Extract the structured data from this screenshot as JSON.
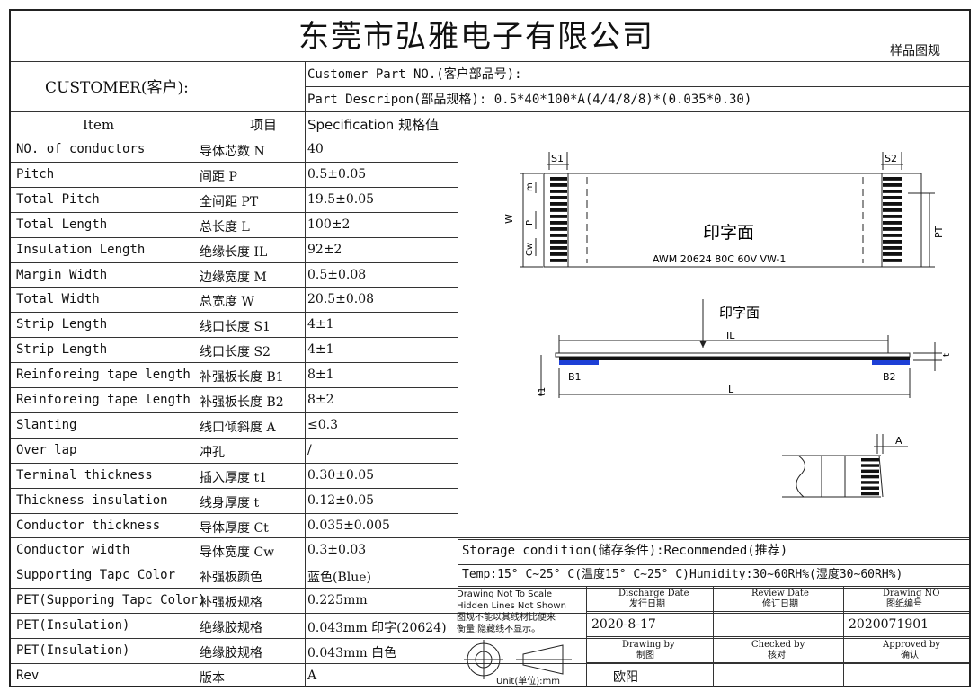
{
  "header": {
    "company": "东莞市弘雅电子有限公司",
    "doc_type": "样品图规"
  },
  "customer": {
    "label": "CUSTOMER(客户):",
    "part_no_label": "Customer Part NO.(客户部品号):",
    "part_desc": "Part Descripon(部品规格): 0.5*40*100*A(4/4/8/8)*(0.035*0.30)"
  },
  "table": {
    "head_item": "Item",
    "head_item_cn": "项目",
    "head_spec": "Specification 规格值",
    "rows": [
      {
        "en": "NO. of conductors",
        "cn": "导体芯数  N",
        "spec": "40"
      },
      {
        "en": "Pitch",
        "cn": "间距      P",
        "spec": "0.5±0.05"
      },
      {
        "en": "Total Pitch",
        "cn": "全间距    PT",
        "spec": "19.5±0.05"
      },
      {
        "en": "Total Length",
        "cn": "总长度    L",
        "spec": "100±2"
      },
      {
        "en": "Insulation Length",
        "cn": "绝缘长度  IL",
        "spec": "92±2"
      },
      {
        "en": "Margin Width",
        "cn": "边缘宽度  M",
        "spec": "0.5±0.08"
      },
      {
        "en": "Total Width",
        "cn": "总宽度    W",
        "spec": "20.5±0.08"
      },
      {
        "en": "Strip Length",
        "cn": "线口长度  S1",
        "spec": "4±1"
      },
      {
        "en": "Strip Length",
        "cn": "线口长度  S2",
        "spec": "4±1"
      },
      {
        "en": "Reinforeing tape length",
        "cn": "补强板长度 B1",
        "spec": "8±1"
      },
      {
        "en": "Reinforeing tape length",
        "cn": "补强板长度 B2",
        "spec": "8±2"
      },
      {
        "en": "Slanting",
        "cn": "线口倾斜度 A",
        "spec": "≤0.3"
      },
      {
        "en": "Over lap",
        "cn": "冲孔",
        "spec": "  /"
      },
      {
        "en": "Terminal thickness",
        "cn": "插入厚度  t1",
        "spec": "0.30±0.05"
      },
      {
        "en": "Thickness insulation",
        "cn": "线身厚度  t",
        "spec": "0.12±0.05"
      },
      {
        "en": "Conductor thickness",
        "cn": "导体厚度  Ct",
        "spec": "0.035±0.005"
      },
      {
        "en": "Conductor width",
        "cn": "导体宽度  Cw",
        "spec": "0.3±0.03"
      },
      {
        "en": "Supporting Tapc Color",
        "cn": "补强板颜色",
        "spec": "蓝色(Blue)"
      },
      {
        "en": "PET(Supporing Tapc Color)",
        "cn": "补强板规格",
        "spec": "0.225mm"
      },
      {
        "en": "PET(Insulation)",
        "cn": "绝缘胶规格",
        "spec": "0.043mm 印字(20624)"
      },
      {
        "en": "PET(Insulation)",
        "cn": "绝缘胶规格",
        "spec": "0.043mm 白色"
      },
      {
        "en": "Rev",
        "cn": "版本",
        "spec": "A"
      }
    ]
  },
  "drawing": {
    "print_face": "印字面",
    "marking": "AWM 20624 80C 60V VW-1",
    "labels": {
      "s1": "S1",
      "s2": "S2",
      "m": "m",
      "p": "P",
      "w": "W",
      "cw": "Cw",
      "pt": "PT",
      "il": "IL",
      "l": "L",
      "b1": "B1",
      "b2": "B2",
      "t": "t",
      "t1": "t1",
      "a": "A"
    },
    "colors": {
      "reinforce": "#1d3fd6",
      "cable": "#111111"
    }
  },
  "notes": {
    "storage": "Storage condition(储存条件):Recommended(推荐)",
    "temp": "Temp:15° C~25° C(温度15° C~25° C)Humidity:30~60RH%(湿度30~60RH%)"
  },
  "title_block": {
    "scale_note_1": "Drawing Not To Scale",
    "scale_note_2": "Hidden Lines Not Shown",
    "scale_note_3": "图规不能以其线材比便来",
    "scale_note_4": "衡量,隐藏线不显示。",
    "unit": "Unit(单位):mm",
    "discharge_en": "Discharge Date",
    "discharge_cn": "发行日期",
    "review_en": "Review Date",
    "review_cn": "修订日期",
    "drawno_en": "Drawing NO",
    "drawno_cn": "图纸编号",
    "discharge_val": "2020-8-17",
    "drawno_val": "2020071901",
    "drawnby_en": "Drawing by",
    "drawnby_cn": "制图",
    "checked_en": "Checked by",
    "checked_cn": "核对",
    "approved_en": "Approved by",
    "approved_cn": "确认",
    "drawnby_val": "欧阳"
  }
}
